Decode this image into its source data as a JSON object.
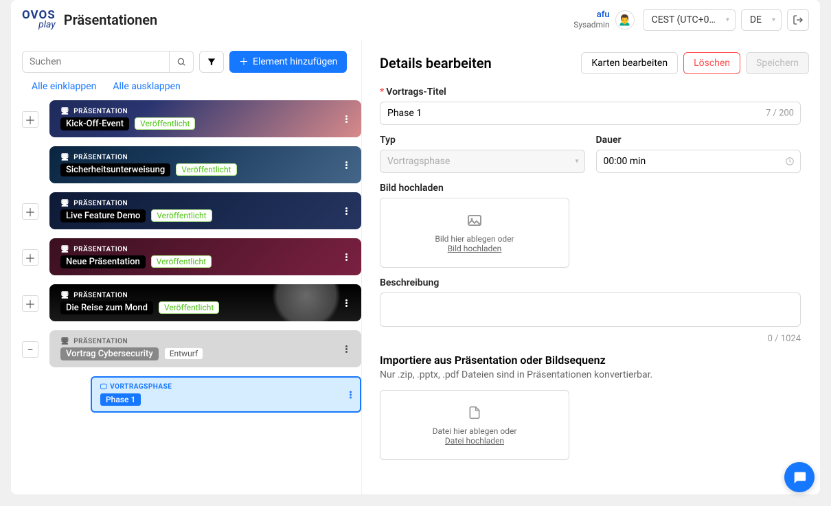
{
  "header": {
    "logo_top": "OVOS",
    "logo_bottom": "play",
    "title": "Präsentationen",
    "user_name": "afu",
    "user_role": "Sysadmin",
    "timezone": "CEST (UTC+0…",
    "language": "DE"
  },
  "sidebar": {
    "search_placeholder": "Suchen",
    "add_button": "Element hinzufügen",
    "collapse_all": "Alle einklappen",
    "expand_all": "Alle ausklappen",
    "tag_label": "PRÄSENTATION",
    "status_published": "Veröffentlicht",
    "status_draft": "Entwurf",
    "items": [
      {
        "title": "Kick-Off-Event",
        "status": "published"
      },
      {
        "title": "Sicherheitsunterweisung",
        "status": "published"
      },
      {
        "title": "Live Feature Demo",
        "status": "published"
      },
      {
        "title": "Neue Präsentation",
        "status": "published"
      },
      {
        "title": "Die Reise zum Mond",
        "status": "published"
      },
      {
        "title": "Vortrag Cybersecurity",
        "status": "draft"
      }
    ],
    "phase": {
      "tag": "VORTRAGSPHASE",
      "title": "Phase 1"
    }
  },
  "details": {
    "title": "Details bearbeiten",
    "edit_cards": "Karten bearbeiten",
    "delete": "Löschen",
    "save": "Speichern",
    "fields": {
      "title_label": "Vortrags-Titel",
      "title_value": "Phase 1",
      "title_count": "7 / 200",
      "type_label": "Typ",
      "type_value": "Vortragsphase",
      "duration_label": "Dauer",
      "duration_value": "00:00 min",
      "upload_label": "Bild hochladen",
      "upload_hint_1": "Bild hier ablegen oder",
      "upload_hint_2": "Bild hochladen",
      "desc_label": "Beschreibung",
      "desc_count": "0 / 1024",
      "import_title": "Importiere aus Präsentation oder Bildsequenz",
      "import_hint": "Nur .zip, .pptx, .pdf Dateien sind in Präsentationen konvertierbar.",
      "file_hint_1": "Datei hier ablegen oder",
      "file_hint_2": "Datei hochladen"
    }
  }
}
